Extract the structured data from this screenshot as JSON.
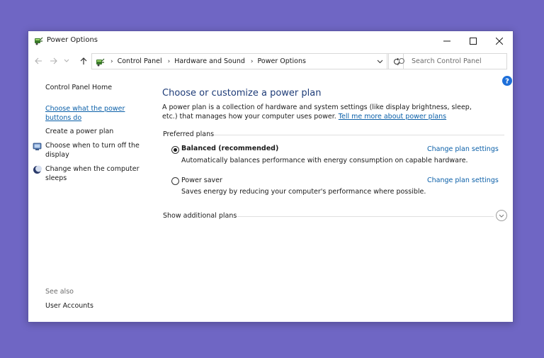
{
  "window": {
    "title": "Power Options"
  },
  "address": {
    "crumbs": [
      "Control Panel",
      "Hardware and Sound",
      "Power Options"
    ]
  },
  "search": {
    "placeholder": "Search Control Panel"
  },
  "left_pane": {
    "home": "Control Panel Home",
    "power_buttons": "Choose what the power buttons do",
    "create_plan": "Create a power plan",
    "turn_off_display": "Choose when to turn off the display",
    "sleep": "Change when the computer sleeps",
    "see_also_label": "See also",
    "user_accounts": "User Accounts"
  },
  "main": {
    "heading": "Choose or customize a power plan",
    "intro_text": "A power plan is a collection of hardware and system settings (like display brightness, sleep, etc.) that manages how your computer uses power. ",
    "intro_link": "Tell me more about power plans",
    "preferred_label": "Preferred plans",
    "plans": [
      {
        "name": "Balanced (recommended)",
        "description": "Automatically balances performance with energy consumption on capable hardware.",
        "link": "Change plan settings",
        "selected": true
      },
      {
        "name": "Power saver",
        "description": "Saves energy by reducing your computer's performance where possible.",
        "link": "Change plan settings",
        "selected": false
      }
    ],
    "show_additional": "Show additional plans"
  },
  "colors": {
    "background": "#6f66c4",
    "link": "#0a5fa8",
    "heading": "#1e3c78"
  }
}
